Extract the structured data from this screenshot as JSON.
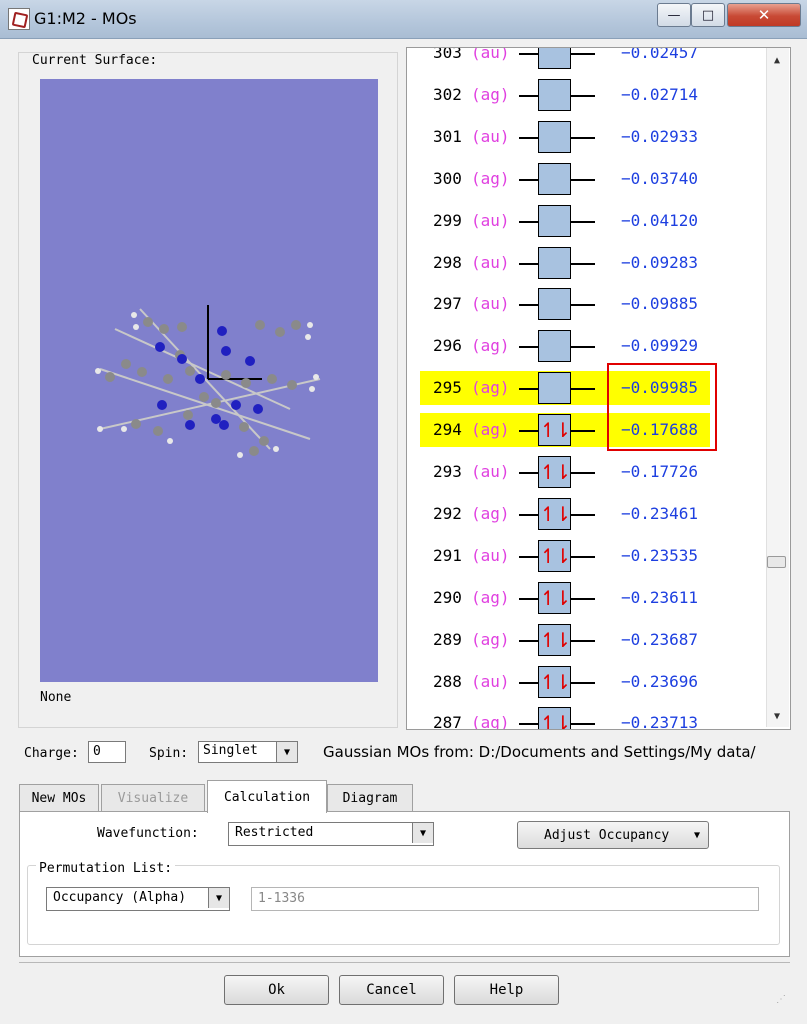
{
  "window": {
    "title": "G1:M2 - MOs"
  },
  "title_buttons": {
    "minimize": "—",
    "maximize": "□",
    "close": "✕"
  },
  "surface": {
    "label": "Current Surface:",
    "status": "None",
    "background_color": "#8080cc"
  },
  "mo_list": {
    "orbitals": [
      {
        "num": "303",
        "sym": "(au)",
        "energy": "-0.02457",
        "occupied": false,
        "highlight": false
      },
      {
        "num": "302",
        "sym": "(ag)",
        "energy": "-0.02714",
        "occupied": false,
        "highlight": false
      },
      {
        "num": "301",
        "sym": "(au)",
        "energy": "-0.02933",
        "occupied": false,
        "highlight": false
      },
      {
        "num": "300",
        "sym": "(ag)",
        "energy": "-0.03740",
        "occupied": false,
        "highlight": false
      },
      {
        "num": "299",
        "sym": "(au)",
        "energy": "-0.04120",
        "occupied": false,
        "highlight": false
      },
      {
        "num": "298",
        "sym": "(au)",
        "energy": "-0.09283",
        "occupied": false,
        "highlight": false
      },
      {
        "num": "297",
        "sym": "(au)",
        "energy": "-0.09885",
        "occupied": false,
        "highlight": false
      },
      {
        "num": "296",
        "sym": "(ag)",
        "energy": "-0.09929",
        "occupied": false,
        "highlight": false
      },
      {
        "num": "295",
        "sym": "(ag)",
        "energy": "-0.09985",
        "occupied": false,
        "highlight": true
      },
      {
        "num": "294",
        "sym": "(ag)",
        "energy": "-0.17688",
        "occupied": true,
        "highlight": true
      },
      {
        "num": "293",
        "sym": "(au)",
        "energy": "-0.17726",
        "occupied": true,
        "highlight": false
      },
      {
        "num": "292",
        "sym": "(ag)",
        "energy": "-0.23461",
        "occupied": true,
        "highlight": false
      },
      {
        "num": "291",
        "sym": "(au)",
        "energy": "-0.23535",
        "occupied": true,
        "highlight": false
      },
      {
        "num": "290",
        "sym": "(ag)",
        "energy": "-0.23611",
        "occupied": true,
        "highlight": false
      },
      {
        "num": "289",
        "sym": "(ag)",
        "energy": "-0.23687",
        "occupied": true,
        "highlight": false
      },
      {
        "num": "288",
        "sym": "(au)",
        "energy": "-0.23696",
        "occupied": true,
        "highlight": false
      },
      {
        "num": "287",
        "sym": "(ag)",
        "energy": "-0.23713",
        "occupied": true,
        "highlight": false
      }
    ],
    "electron_glyph": "↿⇂",
    "colors": {
      "energy": "#1d3fe0",
      "symmetry": "#e040e0",
      "highlight": "#ffff00",
      "box": "#a8c2e0",
      "electron": "#e00000"
    }
  },
  "scrollbar": {
    "up": "▲",
    "down": "▼"
  },
  "charge": {
    "label": "Charge:",
    "value": "0"
  },
  "spin": {
    "label": "Spin:",
    "value": "Singlet"
  },
  "gaussian_source": "Gaussian MOs from:  D:/Documents and Settings/My data/",
  "tabs": [
    {
      "label": "New MOs",
      "active": false,
      "disabled": false
    },
    {
      "label": "Visualize",
      "active": false,
      "disabled": true
    },
    {
      "label": "Calculation",
      "active": true,
      "disabled": false
    },
    {
      "label": "Diagram",
      "active": false,
      "disabled": false
    }
  ],
  "calculation": {
    "wavefunction_label": "Wavefunction:",
    "wavefunction_value": "Restricted",
    "adjust_occupancy_label": "Adjust Occupancy",
    "permutation_label": "Permutation List:",
    "occupancy_value": "Occupancy (Alpha)",
    "range_placeholder": "1-1336"
  },
  "buttons": {
    "ok": "Ok",
    "cancel": "Cancel",
    "help": "Help"
  },
  "dropdown_arrow": "▼"
}
